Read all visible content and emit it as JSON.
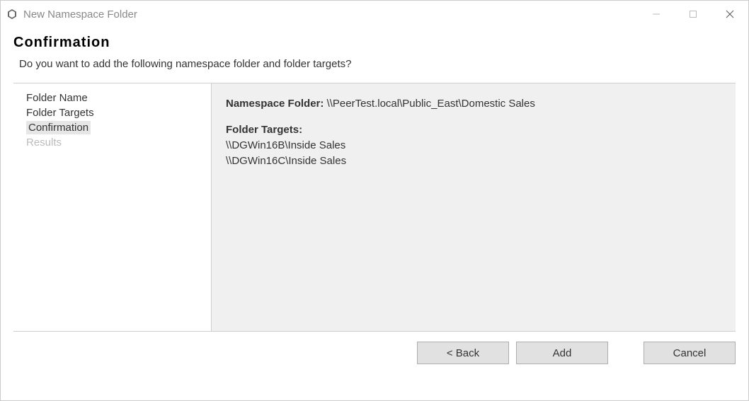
{
  "window": {
    "title": "New Namespace Folder"
  },
  "header": {
    "heading": "Confirmation",
    "subtitle": "Do you want to add the following namespace folder and folder targets?"
  },
  "sidebar": {
    "items": [
      {
        "label": "Folder Name"
      },
      {
        "label": "Folder Targets"
      },
      {
        "label": "Confirmation"
      },
      {
        "label": "Results"
      }
    ]
  },
  "main": {
    "namespace_label": "Namespace Folder:",
    "namespace_value": "\\\\PeerTest.local\\Public_East\\Domestic Sales",
    "targets_label": "Folder Targets:",
    "targets": [
      "\\\\DGWin16B\\Inside Sales",
      "\\\\DGWin16C\\Inside Sales"
    ]
  },
  "footer": {
    "back_label": "< Back",
    "add_label": "Add",
    "cancel_label": "Cancel"
  }
}
